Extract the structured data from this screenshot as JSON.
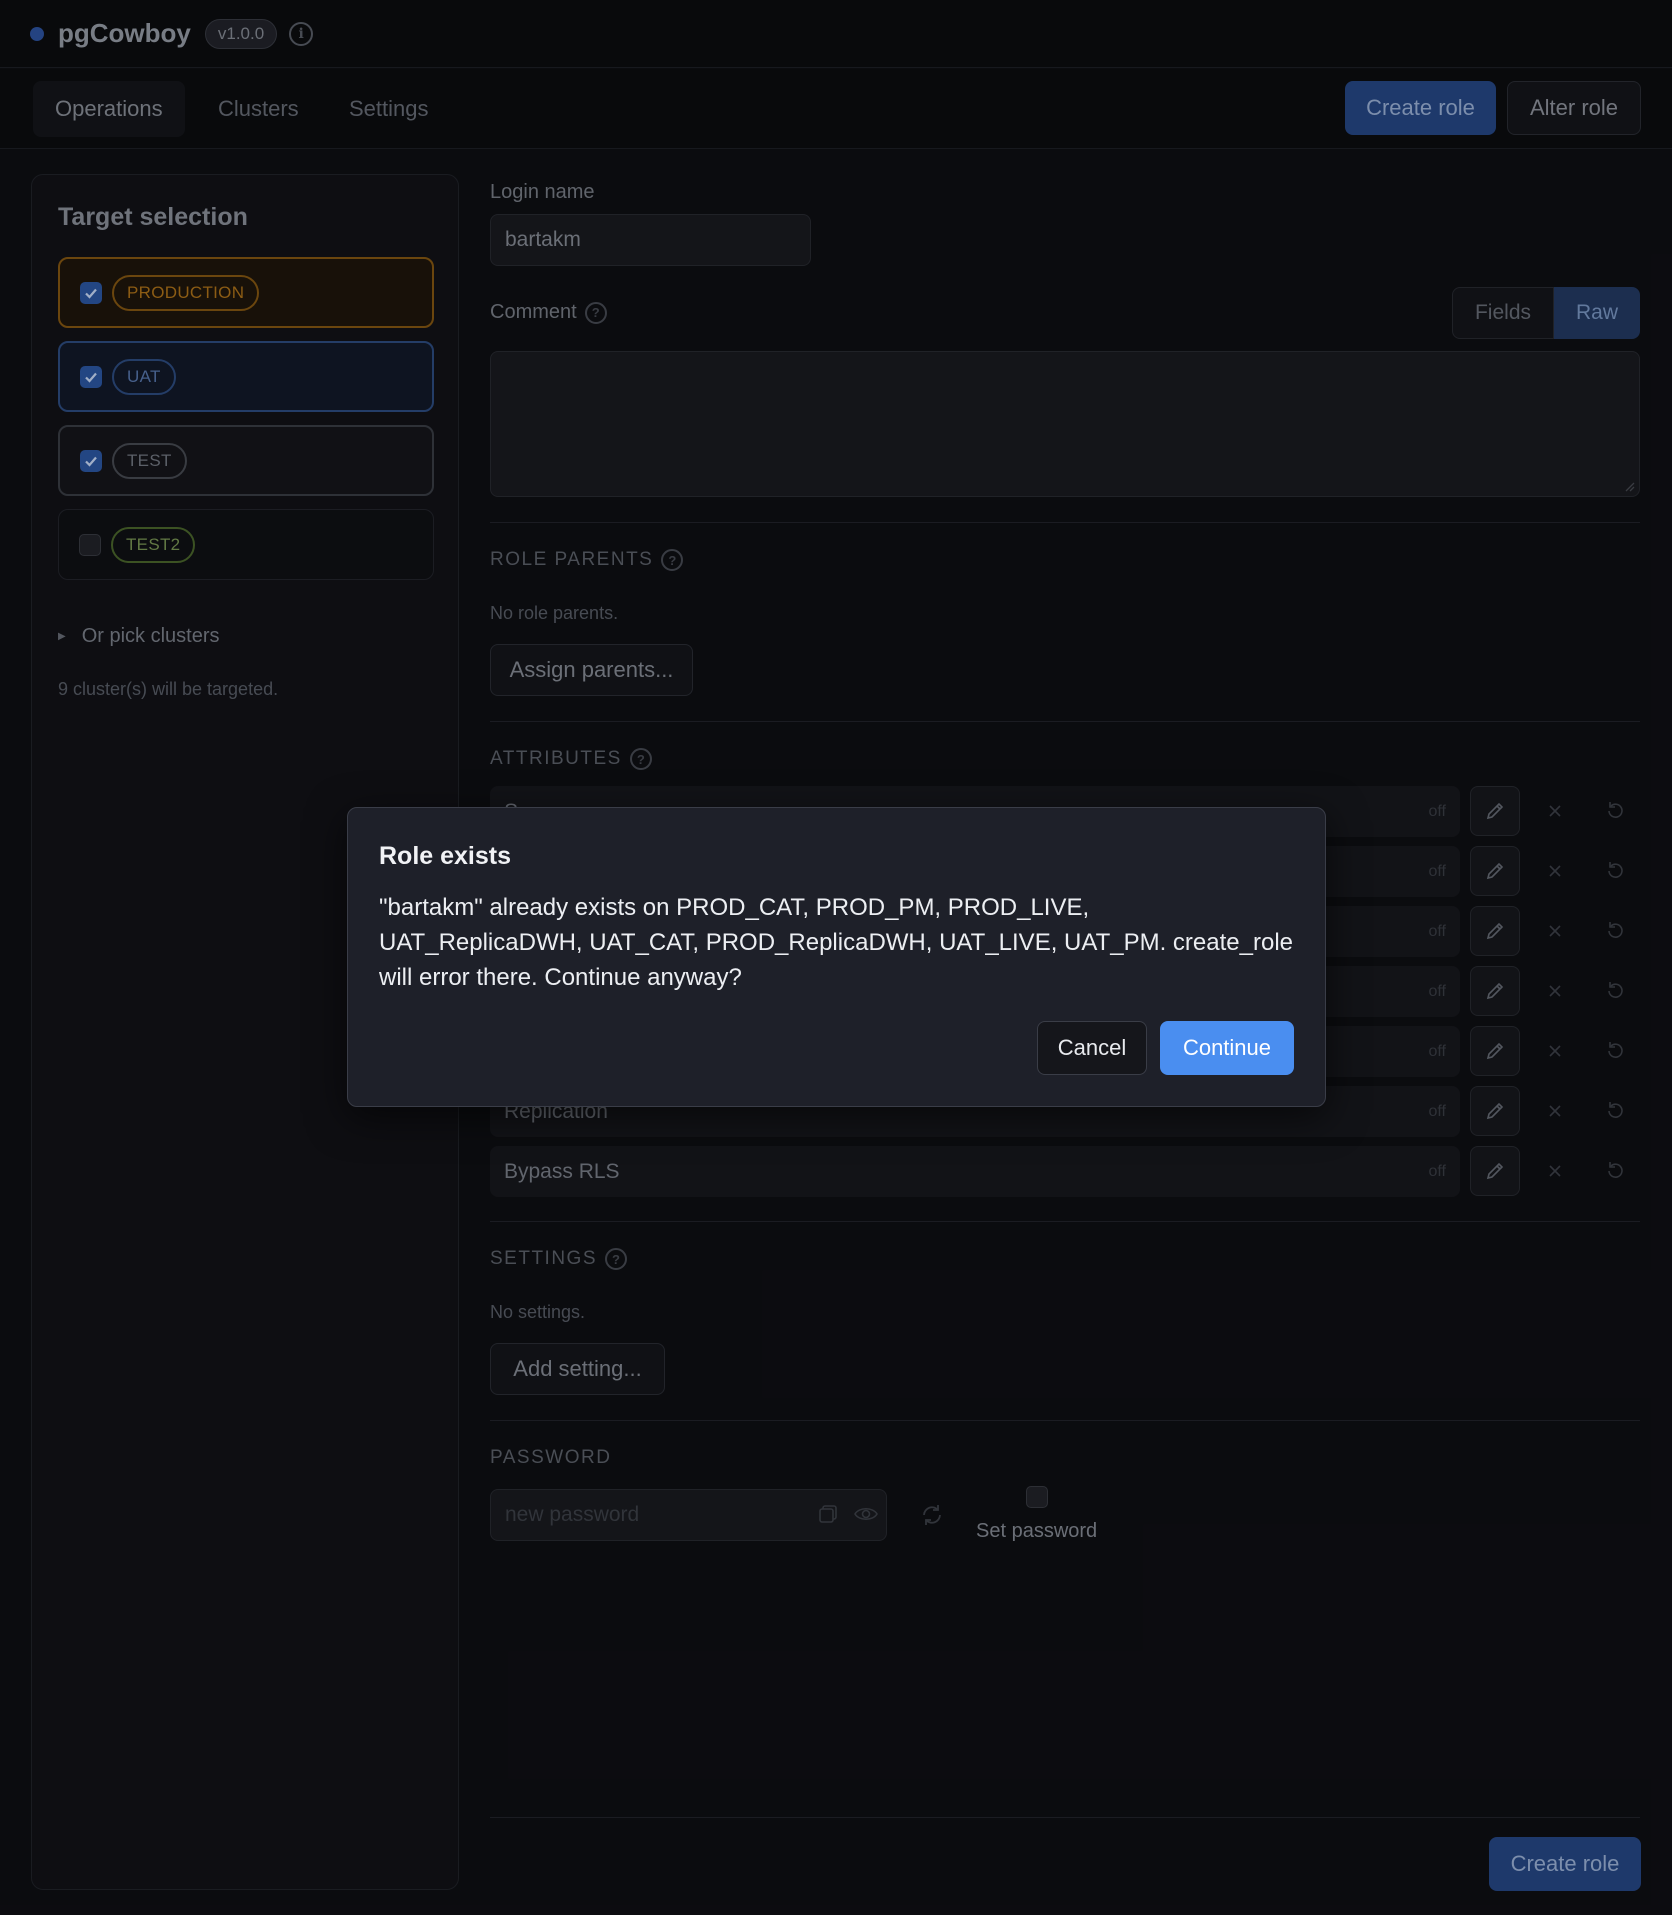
{
  "header": {
    "app_title": "pgCowboy",
    "version": "v1.0.0",
    "status_color": "#2f56a6"
  },
  "nav": {
    "tabs": [
      {
        "label": "Operations",
        "active": true
      },
      {
        "label": "Clusters",
        "active": false
      },
      {
        "label": "Settings",
        "active": false
      }
    ],
    "create_role": "Create role",
    "alter_role": "Alter role"
  },
  "sidebar": {
    "title": "Target selection",
    "targets": [
      {
        "label": "PRODUCTION",
        "checked": true,
        "color": "#b4761a"
      },
      {
        "label": "UAT",
        "checked": true,
        "color": "#5b7bb3"
      },
      {
        "label": "TEST",
        "checked": true,
        "color": "#777c86"
      },
      {
        "label": "TEST2",
        "checked": false,
        "color": "#7e9c58"
      }
    ],
    "pick_clusters": "Or pick clusters",
    "targeted_text": "9 cluster(s) will be targeted."
  },
  "form": {
    "login_name_label": "Login name",
    "login_name_value": "bartakm",
    "comment_label": "Comment",
    "view_fields": "Fields",
    "view_raw": "Raw",
    "role_parents_label": "ROLE PARENTS",
    "no_role_parents": "No role parents.",
    "assign_parents": "Assign parents...",
    "attributes_label": "ATTRIBUTES",
    "attributes": [
      {
        "label": "S",
        "state": "off"
      },
      {
        "label": "",
        "state": "off"
      },
      {
        "label": "",
        "state": "off"
      },
      {
        "label": "",
        "state": "off"
      },
      {
        "label": "",
        "state": "off"
      },
      {
        "label": "Replication",
        "state": "off"
      },
      {
        "label": "Bypass RLS",
        "state": "off"
      }
    ],
    "settings_label": "SETTINGS",
    "no_settings": "No settings.",
    "add_setting": "Add setting...",
    "password_label": "PASSWORD",
    "password_placeholder": "new password",
    "set_password": "Set password",
    "create_role": "Create role"
  },
  "modal": {
    "title": "Role exists",
    "body": "\"bartakm\" already exists on PROD_CAT, PROD_PM, PROD_LIVE, UAT_ReplicaDWH, UAT_CAT, PROD_ReplicaDWH, UAT_LIVE, UAT_PM. create_role will error there. Continue anyway?",
    "cancel": "Cancel",
    "continue": "Continue"
  }
}
